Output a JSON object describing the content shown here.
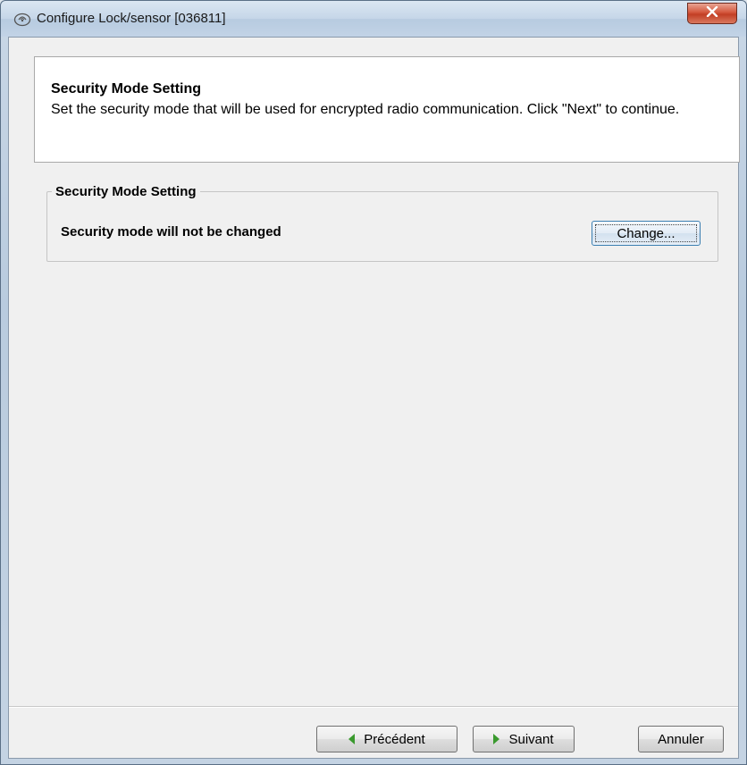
{
  "window": {
    "title": "Configure Lock/sensor [036811]",
    "icon": "wireless-signal-icon",
    "close_icon": "close-icon"
  },
  "header": {
    "title": "Security Mode Setting",
    "description": "Set the security mode that will be used for encrypted radio communication. Click \"Next\" to continue."
  },
  "group": {
    "legend": "Security Mode Setting",
    "status": "Security mode will not be changed",
    "change_label": "Change..."
  },
  "footer": {
    "prev_label": "Précédent",
    "next_label": "Suivant",
    "cancel_label": "Annuler"
  },
  "colors": {
    "accent": "#3c7fb1",
    "arrow_green": "#3a9a2e",
    "close_red": "#c23e24"
  }
}
